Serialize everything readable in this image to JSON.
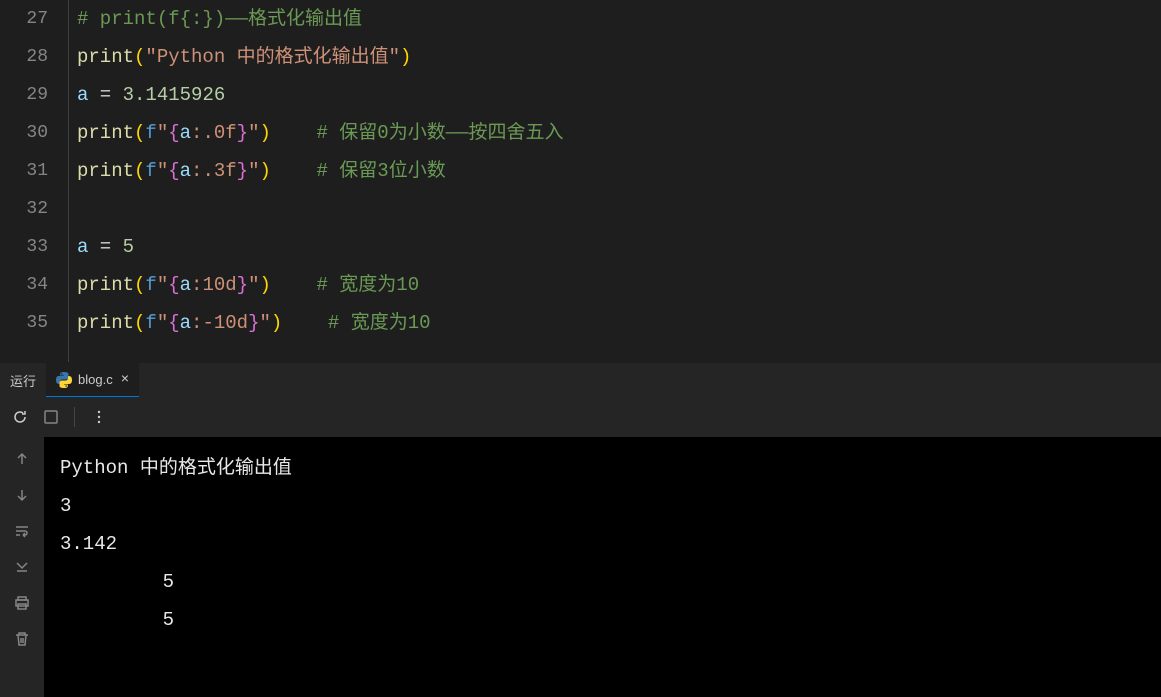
{
  "editor": {
    "lines": [
      {
        "num": "27",
        "tokens": [
          {
            "cls": "comment",
            "text": "# print(f{:})——格式化输出值"
          }
        ]
      },
      {
        "num": "28",
        "tokens": [
          {
            "cls": "keyword",
            "text": "print"
          },
          {
            "cls": "paren",
            "text": "("
          },
          {
            "cls": "string",
            "text": "\"Python 中的格式化输出值\""
          },
          {
            "cls": "paren",
            "text": ")"
          }
        ]
      },
      {
        "num": "29",
        "tokens": [
          {
            "cls": "variable",
            "text": "a"
          },
          {
            "cls": "white",
            "text": " = "
          },
          {
            "cls": "number",
            "text": "3.1415926"
          }
        ]
      },
      {
        "num": "30",
        "tokens": [
          {
            "cls": "keyword",
            "text": "print"
          },
          {
            "cls": "paren",
            "text": "("
          },
          {
            "cls": "fstring-prefix",
            "text": "f"
          },
          {
            "cls": "string",
            "text": "\""
          },
          {
            "cls": "brace-pink",
            "text": "{"
          },
          {
            "cls": "variable",
            "text": "a"
          },
          {
            "cls": "string",
            "text": ":.0f"
          },
          {
            "cls": "brace-pink",
            "text": "}"
          },
          {
            "cls": "string",
            "text": "\""
          },
          {
            "cls": "paren",
            "text": ")"
          },
          {
            "cls": "white",
            "text": "    "
          },
          {
            "cls": "comment",
            "text": "# 保留0为小数——按四舍五入"
          }
        ]
      },
      {
        "num": "31",
        "tokens": [
          {
            "cls": "keyword",
            "text": "print"
          },
          {
            "cls": "paren",
            "text": "("
          },
          {
            "cls": "fstring-prefix",
            "text": "f"
          },
          {
            "cls": "string",
            "text": "\""
          },
          {
            "cls": "brace-pink",
            "text": "{"
          },
          {
            "cls": "variable",
            "text": "a"
          },
          {
            "cls": "string",
            "text": ":.3f"
          },
          {
            "cls": "brace-pink",
            "text": "}"
          },
          {
            "cls": "string",
            "text": "\""
          },
          {
            "cls": "paren",
            "text": ")"
          },
          {
            "cls": "white",
            "text": "    "
          },
          {
            "cls": "comment",
            "text": "# 保留3位小数"
          }
        ]
      },
      {
        "num": "32",
        "tokens": []
      },
      {
        "num": "33",
        "tokens": [
          {
            "cls": "variable",
            "text": "a"
          },
          {
            "cls": "white",
            "text": " = "
          },
          {
            "cls": "number",
            "text": "5"
          }
        ]
      },
      {
        "num": "34",
        "tokens": [
          {
            "cls": "keyword",
            "text": "print"
          },
          {
            "cls": "paren",
            "text": "("
          },
          {
            "cls": "fstring-prefix",
            "text": "f"
          },
          {
            "cls": "string",
            "text": "\""
          },
          {
            "cls": "brace-pink",
            "text": "{"
          },
          {
            "cls": "variable",
            "text": "a"
          },
          {
            "cls": "string",
            "text": ":10d"
          },
          {
            "cls": "brace-pink",
            "text": "}"
          },
          {
            "cls": "string",
            "text": "\""
          },
          {
            "cls": "paren",
            "text": ")"
          },
          {
            "cls": "white",
            "text": "    "
          },
          {
            "cls": "comment",
            "text": "# 宽度为10"
          }
        ]
      },
      {
        "num": "35",
        "tokens": [
          {
            "cls": "keyword",
            "text": "print"
          },
          {
            "cls": "paren",
            "text": "("
          },
          {
            "cls": "fstring-prefix",
            "text": "f"
          },
          {
            "cls": "string",
            "text": "\""
          },
          {
            "cls": "brace-pink",
            "text": "{"
          },
          {
            "cls": "variable",
            "text": "a"
          },
          {
            "cls": "string",
            "text": ":-10d"
          },
          {
            "cls": "brace-pink",
            "text": "}"
          },
          {
            "cls": "string",
            "text": "\""
          },
          {
            "cls": "paren",
            "text": ")"
          },
          {
            "cls": "white",
            "text": "    "
          },
          {
            "cls": "comment",
            "text": "# 宽度为10"
          }
        ]
      }
    ]
  },
  "panel": {
    "label": "运行",
    "tab_name": "blog.c",
    "tab_close": "×"
  },
  "terminal": {
    "output": [
      "Python 中的格式化输出值",
      "3",
      "3.142",
      "         5",
      "         5"
    ]
  }
}
